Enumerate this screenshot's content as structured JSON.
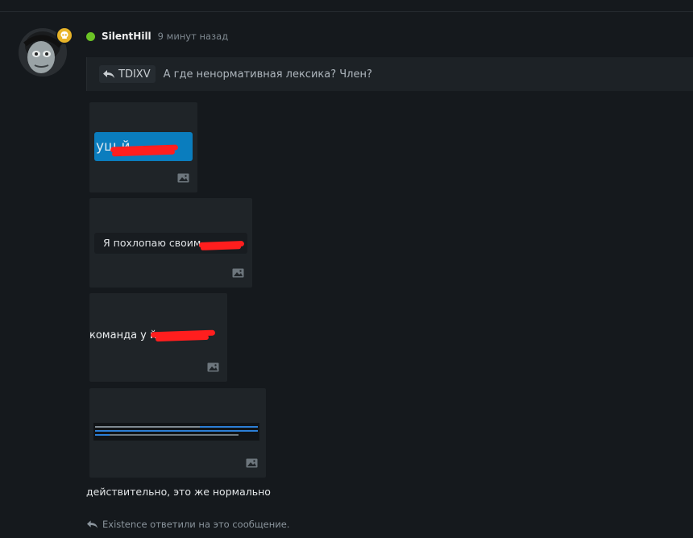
{
  "post": {
    "author": "SilentHill",
    "time_ago": "9 минут назад",
    "online_color": "#6bc325",
    "badge_icon": "skull-icon",
    "badge_color": "#e8b429"
  },
  "quote": {
    "author": "TDIXV",
    "text": "А где ненормативная лексика? Член?",
    "icon": "reply-arrow-icon"
  },
  "attachments": [
    {
      "text": "ущ й",
      "icon": "image-icon"
    },
    {
      "text": "Я похлопаю своим",
      "icon": "image-icon"
    },
    {
      "text": "команда у й,к",
      "icon": "image-icon"
    },
    {
      "icon": "image-icon"
    }
  ],
  "message": "действительно, это же нормально",
  "replies": {
    "text": "Existence ответили на это сообщение.",
    "icon": "reply-arrow-icon"
  },
  "colors": {
    "background": "#15191d",
    "accent_blue": "#0a7dbe",
    "redaction": "#ff1e1e"
  }
}
